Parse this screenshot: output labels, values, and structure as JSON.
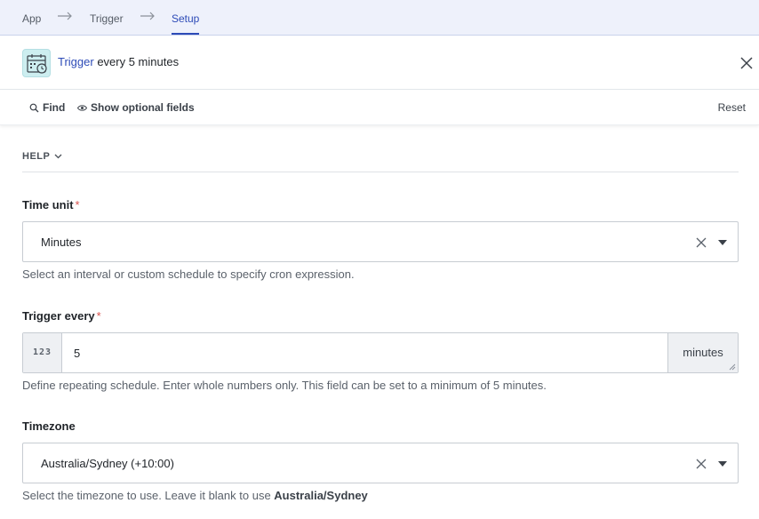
{
  "breadcrumb": {
    "items": [
      "App",
      "Trigger",
      "Setup"
    ],
    "active_index": 2
  },
  "header": {
    "app_icon": "calendar-clock-icon",
    "title_link": "Trigger",
    "title_rest": " every 5 minutes",
    "close_icon": "close-icon"
  },
  "toolbar": {
    "find_label": "Find",
    "optional_label": "Show optional fields",
    "reset_label": "Reset"
  },
  "help": {
    "label": "HELP"
  },
  "fields": {
    "time_unit": {
      "label": "Time unit",
      "required_mark": "*",
      "value": "Minutes",
      "hint": "Select an interval or custom schedule to specify cron expression."
    },
    "trigger_every": {
      "label": "Trigger every",
      "required_mark": "*",
      "prefix": "123",
      "value": "5",
      "suffix": "minutes",
      "hint": "Define repeating schedule. Enter whole numbers only. This field can be set to a minimum of 5 minutes."
    },
    "timezone": {
      "label": "Timezone",
      "value": "Australia/Sydney (+10:00)",
      "hint_text": "Select the timezone to use. Leave it blank to use ",
      "hint_bold": "Australia/Sydney"
    }
  },
  "colors": {
    "accent": "#2d4bb7",
    "required": "#d9534f",
    "breadcrumb_bg": "#eef1fb",
    "badge_bg": "#cdeef0"
  }
}
